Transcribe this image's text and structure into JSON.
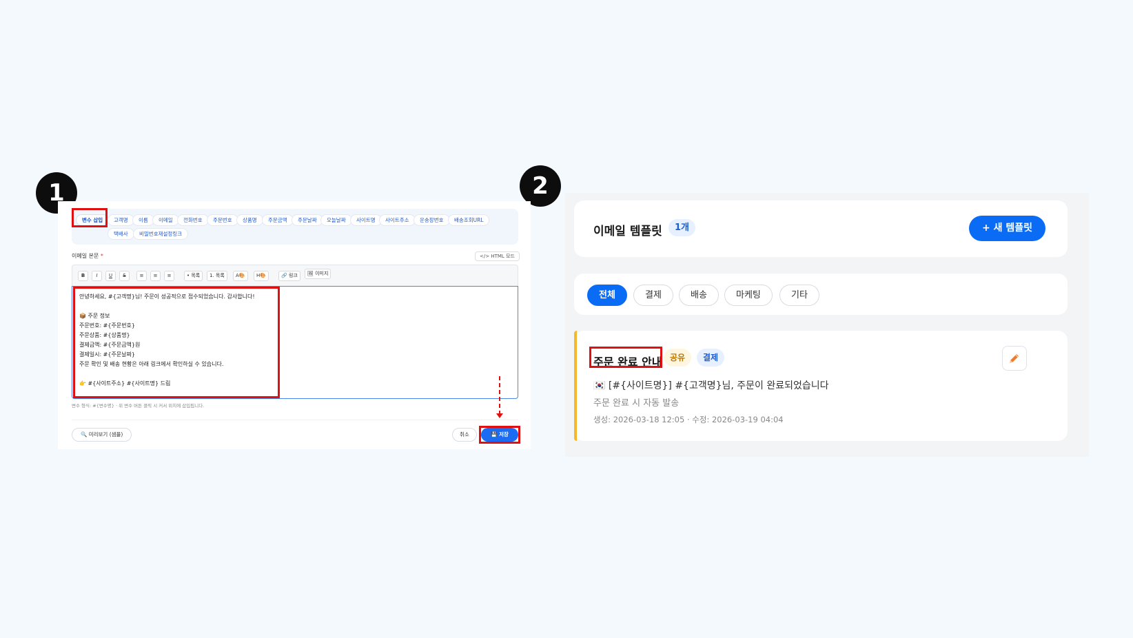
{
  "steps": {
    "one": "1",
    "two": "2"
  },
  "variables": {
    "insert_label": "변수 삽입",
    "chips": [
      "고객명",
      "이름",
      "이메일",
      "전화번호",
      "주문번호",
      "상품명",
      "주문금액",
      "주문날짜",
      "오늘날짜",
      "사이트명",
      "사이트주소",
      "운송장번호",
      "배송조회URL",
      "택배사",
      "비밀번호재설정링크"
    ]
  },
  "editor": {
    "label": "이메일 본문",
    "required_mark": "*",
    "html_mode": "</> HTML 모드",
    "toolbar": {
      "bold": "B",
      "italic": "I",
      "underline": "U",
      "strike": "S",
      "align_left": "≡",
      "align_center": "≡",
      "align_right": "≡",
      "bullet_list": "• 목록",
      "number_list": "1. 목록",
      "font_color": "A🎨",
      "highlight": "H🎨",
      "link": "🔗 링크",
      "image": "🖼 이미지"
    },
    "lines": [
      "안녕하세요, #{고객명}님! 주문이 성공적으로 접수되었습니다. 감사합니다!",
      "",
      "📦 주문 정보",
      "주문번호: #{주문번호}",
      "주문상품: #{상품명}",
      "결제금액: #{주문금액}원",
      "결제일시: #{주문날짜}",
      "주문 확인 및 배송 현황은 아래 링크에서 확인하실 수 있습니다.",
      "",
      "👉 #{사이트주소} #{사이트명} 드림"
    ],
    "hint": "변수 형식: #{변수명} · 위 변수 버튼 클릭 시 커서 위치에 삽입됩니다.",
    "preview_label": "🔍 미리보기 (샘플)",
    "cancel_label": "취소",
    "save_label": "💾 저장"
  },
  "templates": {
    "title": "이메일 템플릿",
    "count": "1개",
    "new_label": "+ 새 템플릿",
    "filters": [
      "전체",
      "결제",
      "배송",
      "마케팅",
      "기타"
    ],
    "active_filter": "전체",
    "items": [
      {
        "name": "주문 완료 안내",
        "shared_badge": "공유",
        "category_badge": "결제",
        "subject": "🇰🇷 [#{사이트명}] #{고객명}님, 주문이 완료되었습니다",
        "description": "주문 완료 시 자동 발송",
        "dates": "생성: 2026-03-18 12:05 · 수정: 2026-03-19 04:04"
      }
    ]
  },
  "colors": {
    "accent": "#0a6cf5",
    "highlight": "#e01010",
    "card_bar": "#f3b82b"
  }
}
